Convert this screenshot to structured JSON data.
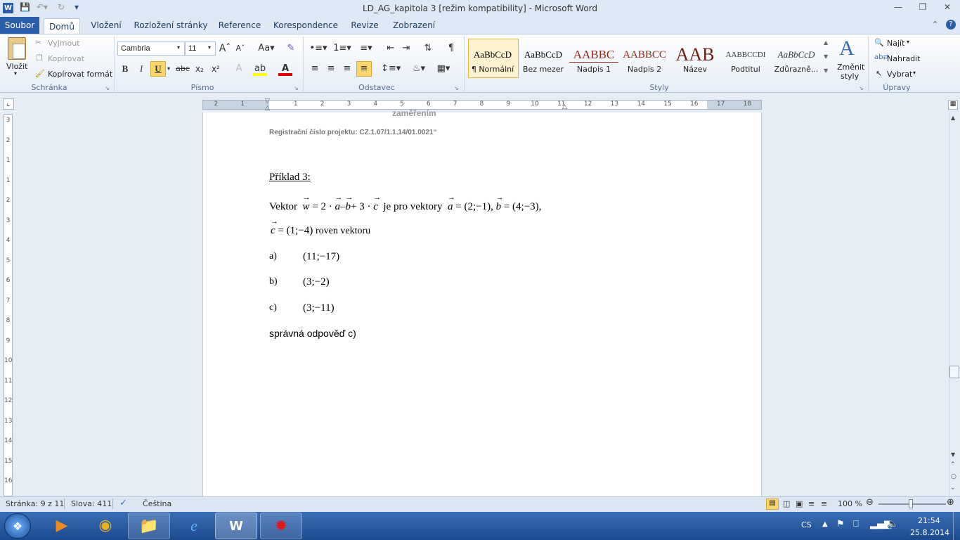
{
  "window": {
    "title": "LD_AG_kapitola 3 [režim kompatibility]  -  Microsoft Word"
  },
  "tabs": {
    "file": "Soubor",
    "home": "Domů",
    "insert": "Vložení",
    "layout": "Rozložení stránky",
    "references": "Reference",
    "mailings": "Korespondence",
    "review": "Revize",
    "view": "Zobrazení"
  },
  "clipboard": {
    "paste": "Vložit",
    "cut": "Vyjmout",
    "copy": "Kopírovat",
    "format_painter": "Kopírovat formát",
    "group": "Schránka"
  },
  "font": {
    "name": "Cambria",
    "size": "11",
    "group": "Písmo"
  },
  "paragraph": {
    "group": "Odstavec"
  },
  "styles": {
    "group": "Styly",
    "change": "Změnit",
    "change2": "styly",
    "items": [
      {
        "sample": "AaBbCcD",
        "name": "¶ Normální",
        "color": "#000000"
      },
      {
        "sample": "AaBbCcD",
        "name": "Bez mezer",
        "color": "#000000"
      },
      {
        "sample": "AABBC",
        "name": "Nadpis 1",
        "color": "#8a2b1b"
      },
      {
        "sample": "AABBCC",
        "name": "Nadpis 2",
        "color": "#8a2b1b"
      },
      {
        "sample": "AAB",
        "name": "Název",
        "color": "#6b2215"
      },
      {
        "sample": "AABBCCDI",
        "name": "Podtitul",
        "color": "#333333"
      },
      {
        "sample": "AaBbCcD",
        "name": "Zdůrazně...",
        "color": "#333333"
      }
    ]
  },
  "editing": {
    "find": "Najít",
    "replace": "Nahradit",
    "select": "Vybrat",
    "group": "Úpravy"
  },
  "ruler": {
    "h": [
      "2",
      "1",
      "1",
      "2",
      "3",
      "4",
      "5",
      "6",
      "7",
      "8",
      "9",
      "10",
      "11",
      "12",
      "13",
      "14",
      "15",
      "16",
      "17",
      "18"
    ],
    "v": [
      "3",
      "2",
      "1",
      "1",
      "2",
      "3",
      "4",
      "5",
      "6",
      "7",
      "8",
      "9",
      "10",
      "11",
      "12",
      "13",
      "14",
      "15",
      "16"
    ]
  },
  "document": {
    "header_partial": "zaměřením",
    "reg_number": "Registrační číslo projektu: CZ.1.07/1.1.14/01.0021“",
    "heading": "Příklad 3:",
    "vektor": "Vektor",
    "w": "w",
    "eq": "= 2 ·",
    "a": "a",
    "minus": "–",
    "b": "b",
    "plus": "+ 3 ·",
    "c": "c",
    "je_pro": "je  pro  vektory",
    "a_eq": "= (2;−1),",
    "b_eq": "= (4;−3),",
    "c_eq": "= (1;−4)",
    "roven": "roven vektoru",
    "options": [
      {
        "label": "a)",
        "value": "(11;−17)"
      },
      {
        "label": "b)",
        "value": "(3;−2)"
      },
      {
        "label": "c)",
        "value": "(3;−11)"
      }
    ],
    "answer": "správná odpověď c)"
  },
  "status": {
    "page": "Stránka: 9 z 11",
    "words": "Slova: 411",
    "language": "Čeština",
    "zoom": "100 %"
  },
  "tray": {
    "lang": "CS",
    "time": "21:54",
    "date": "25.8.2014"
  }
}
